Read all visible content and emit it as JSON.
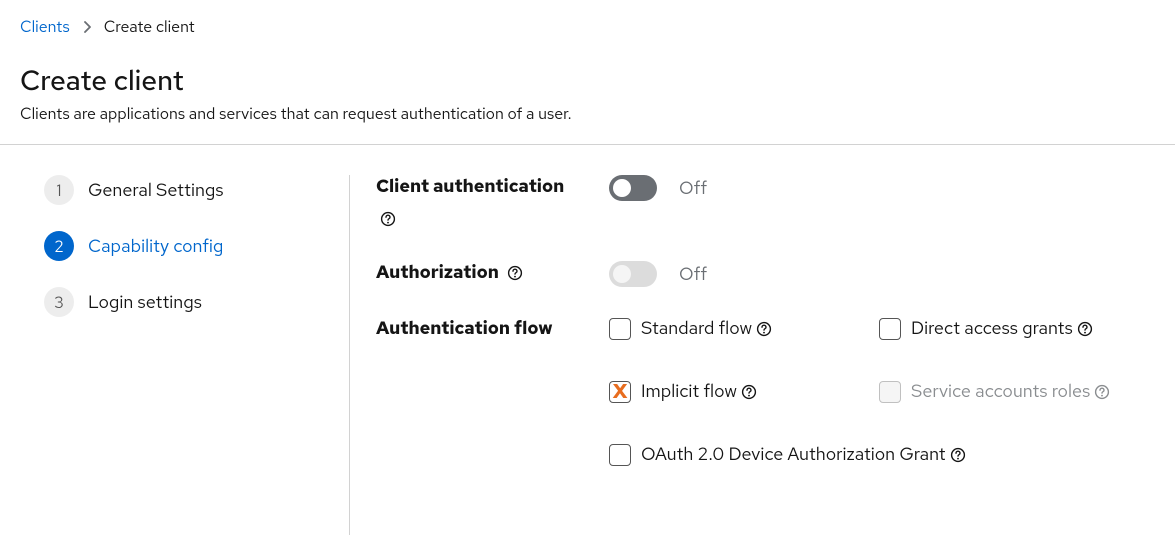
{
  "breadcrumb": {
    "parent": "Clients",
    "current": "Create client"
  },
  "header": {
    "title": "Create client",
    "subtitle": "Clients are applications and services that can request authentication of a user."
  },
  "wizard": {
    "steps": [
      {
        "number": "1",
        "label": "General Settings"
      },
      {
        "number": "2",
        "label": "Capability config"
      },
      {
        "number": "3",
        "label": "Login settings"
      }
    ],
    "active_index": 1
  },
  "form": {
    "client_authentication": {
      "label": "Client authentication",
      "state": "Off"
    },
    "authorization": {
      "label": "Authorization",
      "state": "Off"
    },
    "authentication_flow": {
      "label": "Authentication flow",
      "options": {
        "standard_flow": {
          "label": "Standard flow",
          "checked": false,
          "disabled": false
        },
        "direct_access_grants": {
          "label": "Direct access grants",
          "checked": false,
          "disabled": false
        },
        "implicit_flow": {
          "label": "Implicit flow",
          "checked": true,
          "disabled": false
        },
        "service_accounts_roles": {
          "label": "Service accounts roles",
          "checked": false,
          "disabled": true
        },
        "oauth_device_grant": {
          "label": "OAuth 2.0 Device Authorization Grant",
          "checked": false,
          "disabled": false
        }
      }
    }
  },
  "icons": {
    "chevron_right": "chevron-right-icon",
    "help": "help-icon"
  }
}
